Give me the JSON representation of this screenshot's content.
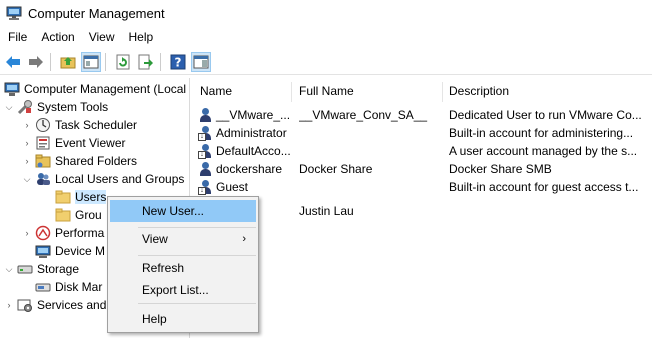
{
  "window": {
    "title": "Computer Management"
  },
  "menubar": {
    "items": [
      "File",
      "Action",
      "View",
      "Help"
    ]
  },
  "toolbar": {
    "buttons": [
      "back-arrow-icon",
      "forward-arrow-icon",
      "up-folder-icon",
      "show-hide-tree-icon",
      "refresh-icon",
      "export-list-icon",
      "help-icon",
      "properties-pane-icon"
    ]
  },
  "tree": {
    "root": "Computer Management (Local",
    "system_tools": "System Tools",
    "task_scheduler": "Task Scheduler",
    "event_viewer": "Event Viewer",
    "shared_folders": "Shared Folders",
    "local_users_groups": "Local Users and Groups",
    "users": "Users",
    "groups": "Grou",
    "performance": "Performa",
    "device_manager": "Device M",
    "storage": "Storage",
    "disk_management": "Disk Mar",
    "services_apps": "Services and"
  },
  "list": {
    "columns": [
      "Name",
      "Full Name",
      "Description"
    ],
    "rows": [
      {
        "name": "__VMware_...",
        "full_name": "__VMware_Conv_SA__",
        "description": "Dedicated User to run VMware Co..."
      },
      {
        "name": "Administrator",
        "full_name": "",
        "description": "Built-in account for administering..."
      },
      {
        "name": "DefaultAcco...",
        "full_name": "",
        "description": "A user account managed by the s..."
      },
      {
        "name": "dockershare",
        "full_name": "Docker Share",
        "description": "Docker Share SMB"
      },
      {
        "name": "Guest",
        "full_name": "",
        "description": "Built-in account for guest access t..."
      },
      {
        "name": "",
        "full_name": "Justin Lau",
        "description": ""
      }
    ]
  },
  "context_menu": {
    "new_user": "New User...",
    "view": "View",
    "refresh": "Refresh",
    "export_list": "Export List...",
    "help": "Help",
    "submenu_arrow": "›"
  },
  "colors": {
    "selection": "#cce8ff",
    "menu_hover": "#91c9f7",
    "menu_bg": "#f2f2f2"
  }
}
